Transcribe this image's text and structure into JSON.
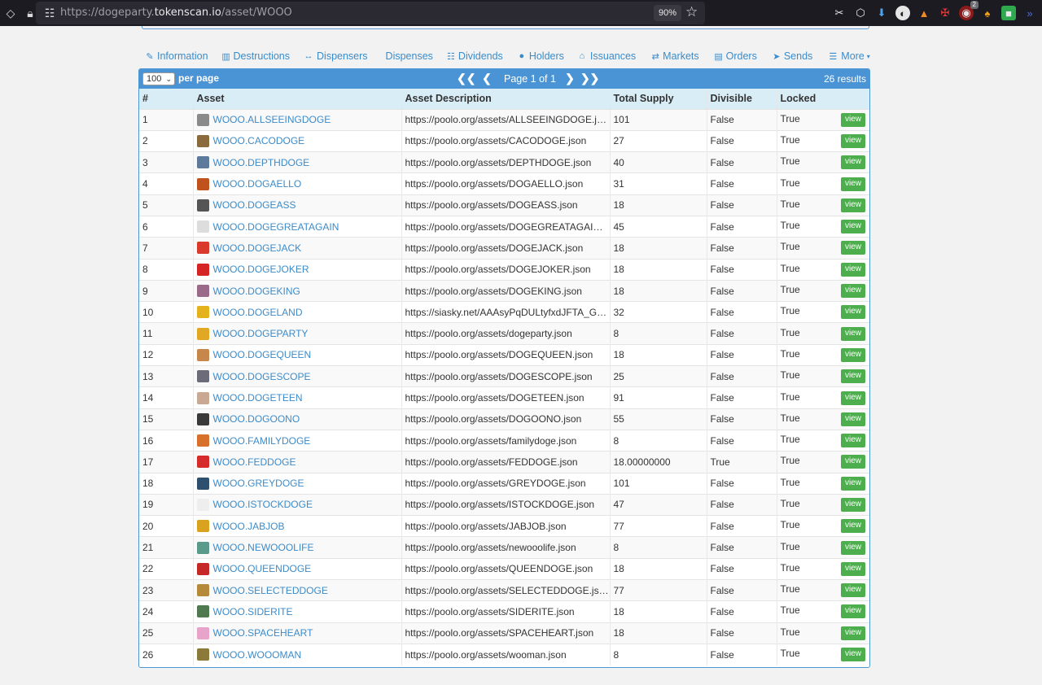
{
  "browser": {
    "url_prefix": "https://dogeparty.",
    "url_host": "tokenscan.io",
    "url_path": "/asset/WOOO",
    "zoom": "90%",
    "ext_badge": "2"
  },
  "tabs": [
    {
      "label": "Information",
      "icon": "wrench-icon"
    },
    {
      "label": "Destructions",
      "icon": "trash-icon"
    },
    {
      "label": "Dispensers",
      "icon": "arrows-horizontal-icon"
    },
    {
      "label": "Dispenses",
      "icon": ""
    },
    {
      "label": "Dividends",
      "icon": "sitemap-icon"
    },
    {
      "label": "Holders",
      "icon": "user-icon"
    },
    {
      "label": "Issuances",
      "icon": "bank-icon"
    },
    {
      "label": "Markets",
      "icon": "exchange-icon"
    },
    {
      "label": "Orders",
      "icon": "book-icon"
    },
    {
      "label": "Sends",
      "icon": "send-icon"
    },
    {
      "label": "More",
      "icon": "list-icon"
    }
  ],
  "panel": {
    "per_page_value": "100",
    "per_page_label": "per page",
    "page_text": "Page 1 of 1",
    "results_text": "26 results"
  },
  "table": {
    "columns": [
      "#",
      "Asset",
      "Asset Description",
      "Total Supply",
      "Divisible",
      "Locked"
    ],
    "view_label": "view",
    "rows": [
      {
        "n": "1",
        "asset": "WOOO.ALLSEEINGDOGE",
        "desc": "https://poolo.org/assets/ALLSEEINGDOGE.json",
        "supply": "101",
        "divisible": "False",
        "locked": "True",
        "icon_color": "#8a8a8a"
      },
      {
        "n": "2",
        "asset": "WOOO.CACODOGE",
        "desc": "https://poolo.org/assets/CACODOGE.json",
        "supply": "27",
        "divisible": "False",
        "locked": "True",
        "icon_color": "#8b6a3e"
      },
      {
        "n": "3",
        "asset": "WOOO.DEPTHDOGE",
        "desc": "https://poolo.org/assets/DEPTHDOGE.json",
        "supply": "40",
        "divisible": "False",
        "locked": "True",
        "icon_color": "#5d7a9c"
      },
      {
        "n": "4",
        "asset": "WOOO.DOGAELLO",
        "desc": "https://poolo.org/assets/DOGAELLO.json",
        "supply": "31",
        "divisible": "False",
        "locked": "True",
        "icon_color": "#c0521e"
      },
      {
        "n": "5",
        "asset": "WOOO.DOGEASS",
        "desc": "https://poolo.org/assets/DOGEASS.json",
        "supply": "18",
        "divisible": "False",
        "locked": "True",
        "icon_color": "#555555"
      },
      {
        "n": "6",
        "asset": "WOOO.DOGEGREATAGAIN",
        "desc": "https://poolo.org/assets/DOGEGREATAGAIN.json",
        "supply": "45",
        "divisible": "False",
        "locked": "True",
        "icon_color": "#dddddd"
      },
      {
        "n": "7",
        "asset": "WOOO.DOGEJACK",
        "desc": "https://poolo.org/assets/DOGEJACK.json",
        "supply": "18",
        "divisible": "False",
        "locked": "True",
        "icon_color": "#d93a2b"
      },
      {
        "n": "8",
        "asset": "WOOO.DOGEJOKER",
        "desc": "https://poolo.org/assets/DOGEJOKER.json",
        "supply": "18",
        "divisible": "False",
        "locked": "True",
        "icon_color": "#d42424"
      },
      {
        "n": "9",
        "asset": "WOOO.DOGEKING",
        "desc": "https://poolo.org/assets/DOGEKING.json",
        "supply": "18",
        "divisible": "False",
        "locked": "True",
        "icon_color": "#9a6a8a"
      },
      {
        "n": "10",
        "asset": "WOOO.DOGELAND",
        "desc": "https://siasky.net/AAAsyPqDULtyfxdJFTA_GAbc.json",
        "supply": "32",
        "divisible": "False",
        "locked": "True",
        "icon_color": "#e3b21c"
      },
      {
        "n": "11",
        "asset": "WOOO.DOGEPARTY",
        "desc": "https://poolo.org/assets/dogeparty.json",
        "supply": "8",
        "divisible": "False",
        "locked": "True",
        "icon_color": "#e0a825"
      },
      {
        "n": "12",
        "asset": "WOOO.DOGEQUEEN",
        "desc": "https://poolo.org/assets/DOGEQUEEN.json",
        "supply": "18",
        "divisible": "False",
        "locked": "True",
        "icon_color": "#c7874b"
      },
      {
        "n": "13",
        "asset": "WOOO.DOGESCOPE",
        "desc": "https://poolo.org/assets/DOGESCOPE.json",
        "supply": "25",
        "divisible": "False",
        "locked": "True",
        "icon_color": "#6b6b7a"
      },
      {
        "n": "14",
        "asset": "WOOO.DOGETEEN",
        "desc": "https://poolo.org/assets/DOGETEEN.json",
        "supply": "91",
        "divisible": "False",
        "locked": "True",
        "icon_color": "#c9a894"
      },
      {
        "n": "15",
        "asset": "WOOO.DOGOONO",
        "desc": "https://poolo.org/assets/DOGOONO.json",
        "supply": "55",
        "divisible": "False",
        "locked": "True",
        "icon_color": "#3a3a3a"
      },
      {
        "n": "16",
        "asset": "WOOO.FAMILYDOGE",
        "desc": "https://poolo.org/assets/familydoge.json",
        "supply": "8",
        "divisible": "False",
        "locked": "True",
        "icon_color": "#d6702a"
      },
      {
        "n": "17",
        "asset": "WOOO.FEDDOGE",
        "desc": "https://poolo.org/assets/FEDDOGE.json",
        "supply": "18.00000000",
        "divisible": "True",
        "locked": "True",
        "icon_color": "#d62b2b"
      },
      {
        "n": "18",
        "asset": "WOOO.GREYDOGE",
        "desc": "https://poolo.org/assets/GREYDOGE.json",
        "supply": "101",
        "divisible": "False",
        "locked": "True",
        "icon_color": "#2f4f6f"
      },
      {
        "n": "19",
        "asset": "WOOO.ISTOCKDOGE",
        "desc": "https://poolo.org/assets/ISTOCKDOGE.json",
        "supply": "47",
        "divisible": "False",
        "locked": "True",
        "icon_color": "#eeeeee"
      },
      {
        "n": "20",
        "asset": "WOOO.JABJOB",
        "desc": "https://poolo.org/assets/JABJOB.json",
        "supply": "77",
        "divisible": "False",
        "locked": "True",
        "icon_color": "#d9a21f"
      },
      {
        "n": "21",
        "asset": "WOOO.NEWOOOLIFE",
        "desc": "https://poolo.org/assets/newooolife.json",
        "supply": "8",
        "divisible": "False",
        "locked": "True",
        "icon_color": "#5a9a8a"
      },
      {
        "n": "22",
        "asset": "WOOO.QUEENDOGE",
        "desc": "https://poolo.org/assets/QUEENDOGE.json",
        "supply": "18",
        "divisible": "False",
        "locked": "True",
        "icon_color": "#c62828"
      },
      {
        "n": "23",
        "asset": "WOOO.SELECTEDDOGE",
        "desc": "https://poolo.org/assets/SELECTEDDOGE.json",
        "supply": "77",
        "divisible": "False",
        "locked": "True",
        "icon_color": "#b58a3a"
      },
      {
        "n": "24",
        "asset": "WOOO.SIDERITE",
        "desc": "https://poolo.org/assets/SIDERITE.json",
        "supply": "18",
        "divisible": "False",
        "locked": "True",
        "icon_color": "#4f7a4f"
      },
      {
        "n": "25",
        "asset": "WOOO.SPACEHEART",
        "desc": "https://poolo.org/assets/SPACEHEART.json",
        "supply": "18",
        "divisible": "False",
        "locked": "True",
        "icon_color": "#e7a3c9"
      },
      {
        "n": "26",
        "asset": "WOOO.WOOOMAN",
        "desc": "https://poolo.org/assets/wooman.json",
        "supply": "8",
        "divisible": "False",
        "locked": "True",
        "icon_color": "#8c7a3a"
      }
    ]
  }
}
